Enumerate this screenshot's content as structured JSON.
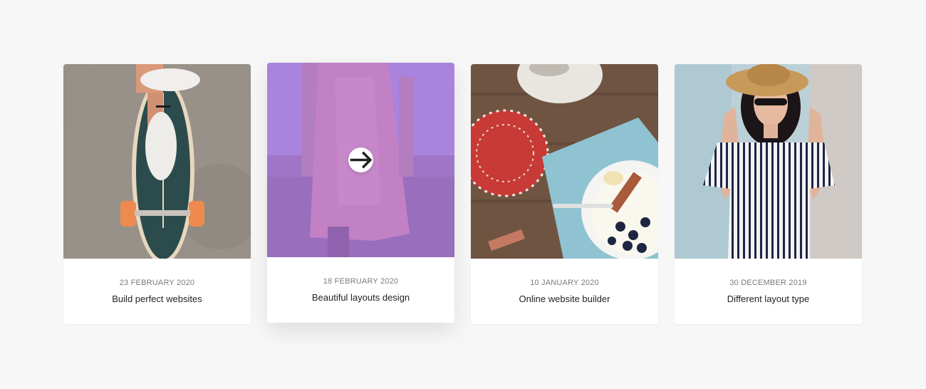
{
  "cards": [
    {
      "date": "23 FEBRUARY 2020",
      "title": "Build perfect websites",
      "image": "skateboard-photo"
    },
    {
      "date": "18 FEBRUARY 2020",
      "title": "Beautiful layouts design",
      "image": "pink-dress-field-photo",
      "overlay_color": "#965ae6",
      "hovered": true,
      "action_icon": "arrow-right-icon"
    },
    {
      "date": "10 JANUARY 2020",
      "title": "Online website builder",
      "image": "breakfast-table-photo"
    },
    {
      "date": "30 DECEMBER 2019",
      "title": "Different layout type",
      "image": "woman-striped-dress-photo"
    }
  ]
}
